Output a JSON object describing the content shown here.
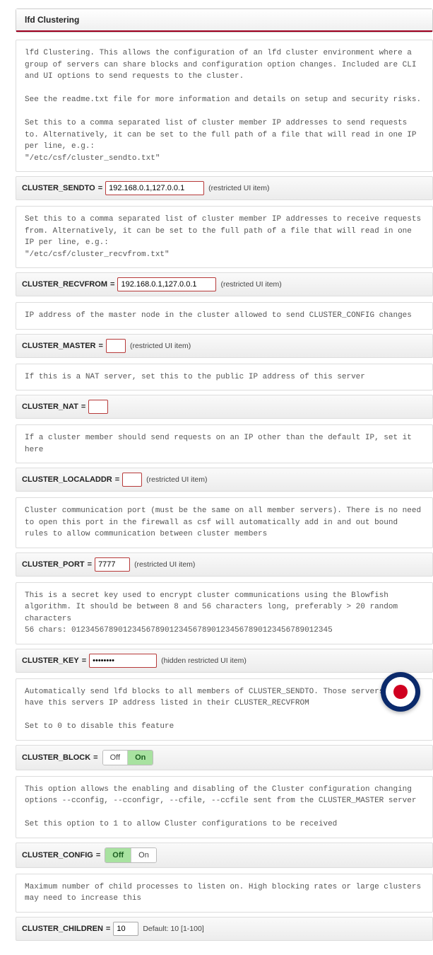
{
  "panelTitle": "lfd Clustering",
  "roundel": {
    "name": "app-roundel-icon"
  },
  "blocks": [
    {
      "help": "lfd Clustering. This allows the configuration of an lfd cluster environment where a group of servers can share blocks and configuration option changes. Included are CLI and UI options to send requests to the cluster.\n\nSee the readme.txt file for more information and details on setup and security risks.\n\nSet this to a comma separated list of cluster member IP addresses to send requests to. Alternatively, it can be set to the full path of a file that will read in one IP per line, e.g.:\n\"/etc/csf/cluster_sendto.txt\"",
      "label": "CLUSTER_SENDTO",
      "value": "192.168.0.1,127.0.0.1",
      "note": "(restricted UI item)",
      "inputWidth": "140px",
      "kind": "text"
    },
    {
      "help": "Set this to a comma separated list of cluster member IP addresses to receive requests from. Alternatively, it can be set to the full path of a file that will read in one IP per line, e.g.:\n\"/etc/csf/cluster_recvfrom.txt\"",
      "label": "CLUSTER_RECVFROM",
      "value": "192.168.0.1,127.0.0.1",
      "note": "(restricted UI item)",
      "inputWidth": "140px",
      "kind": "text"
    },
    {
      "help": "IP address of the master node in the cluster allowed to send CLUSTER_CONFIG changes",
      "label": "CLUSTER_MASTER",
      "value": "",
      "note": "(restricted UI item)",
      "inputWidth": "28px",
      "kind": "text"
    },
    {
      "help": "If this is a NAT server, set this to the public IP address of this server",
      "label": "CLUSTER_NAT",
      "value": "",
      "note": "",
      "inputWidth": "28px",
      "kind": "text"
    },
    {
      "help": "If a cluster member should send requests on an IP other than the default IP, set it here",
      "label": "CLUSTER_LOCALADDR",
      "value": "",
      "note": "(restricted UI item)",
      "inputWidth": "28px",
      "kind": "text"
    },
    {
      "help": "Cluster communication port (must be the same on all member servers). There is no need to open this port in the firewall as csf will automatically add in and out bound rules to allow communication between cluster members",
      "label": "CLUSTER_PORT",
      "value": "7777",
      "note": "(restricted UI item)",
      "inputWidth": "50px",
      "kind": "text"
    },
    {
      "help": "This is a secret key used to encrypt cluster communications using the Blowfish algorithm. It should be between 8 and 56 characters long, preferably > 20 random characters\n56 chars: 01234567890123456789012345678901234567890123456789012345",
      "label": "CLUSTER_KEY",
      "value": "********",
      "note": "(hidden restricted UI item)",
      "inputWidth": "96px",
      "kind": "password"
    },
    {
      "help": "Automatically send lfd blocks to all members of CLUSTER_SENDTO. Those servers must have this servers IP address listed in their CLUSTER_RECVFROM\n\nSet to 0 to disable this feature",
      "label": "CLUSTER_BLOCK",
      "kind": "toggle",
      "options": [
        "Off",
        "On"
      ],
      "active": "On"
    },
    {
      "help": "This option allows the enabling and disabling of the Cluster configuration changing options --cconfig, --cconfigr, --cfile, --ccfile sent from the CLUSTER_MASTER server\n\nSet this option to 1 to allow Cluster configurations to be received",
      "label": "CLUSTER_CONFIG",
      "kind": "toggle",
      "options": [
        "Off",
        "On"
      ],
      "active": "Off"
    },
    {
      "help": "Maximum number of child processes to listen on. High blocking rates or large clusters may need to increase this",
      "label": "CLUSTER_CHILDREN",
      "value": "10",
      "note": "Default: 10 [1-100]",
      "inputWidth": "36px",
      "kind": "textplain"
    }
  ]
}
